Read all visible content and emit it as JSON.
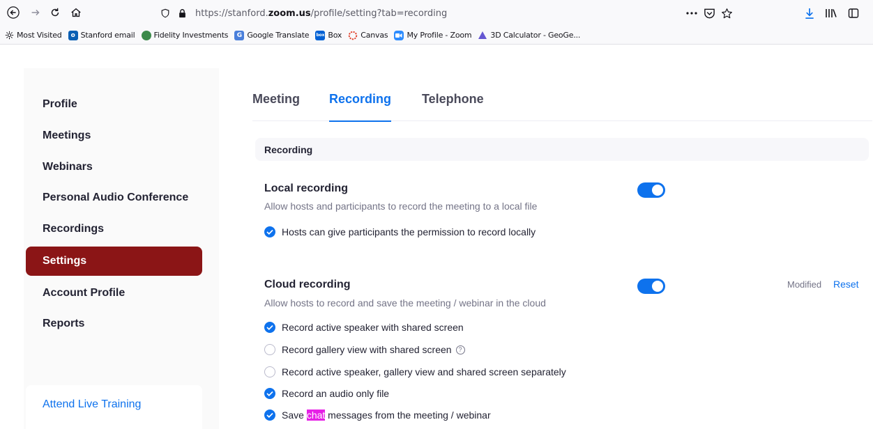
{
  "browser": {
    "url_prefix": "https://stanford.",
    "url_domain": "zoom.us",
    "url_path": "/profile/setting?tab=recording",
    "bookmarks": [
      {
        "label": "Most Visited",
        "icon": "gear-icon"
      },
      {
        "label": "Stanford email",
        "icon": "outlook-icon"
      },
      {
        "label": "Fidelity Investments",
        "icon": "fidelity-icon"
      },
      {
        "label": "Google Translate",
        "icon": "translate-icon"
      },
      {
        "label": "Box",
        "icon": "box-icon"
      },
      {
        "label": "Canvas",
        "icon": "canvas-icon"
      },
      {
        "label": "My Profile - Zoom",
        "icon": "zoom-icon"
      },
      {
        "label": "3D Calculator - GeoGe...",
        "icon": "geogebra-icon"
      }
    ],
    "box_badge": "box"
  },
  "sidebar": {
    "items": [
      {
        "label": "Profile",
        "active": false
      },
      {
        "label": "Meetings",
        "active": false
      },
      {
        "label": "Webinars",
        "active": false
      },
      {
        "label": "Personal Audio Conference",
        "active": false
      },
      {
        "label": "Recordings",
        "active": false
      },
      {
        "label": "Settings",
        "active": true
      },
      {
        "label": "Account Profile",
        "active": false
      },
      {
        "label": "Reports",
        "active": false
      }
    ],
    "training_link": "Attend Live Training"
  },
  "tabs": [
    {
      "label": "Meeting",
      "active": false
    },
    {
      "label": "Recording",
      "active": true
    },
    {
      "label": "Telephone",
      "active": false
    }
  ],
  "section_header": "Recording",
  "local_recording": {
    "title": "Local recording",
    "description": "Allow hosts and participants to record the meeting to a local file",
    "enabled": true,
    "options": [
      {
        "label": "Hosts can give participants the permission to record locally",
        "checked": true
      }
    ]
  },
  "cloud_recording": {
    "title": "Cloud recording",
    "description": "Allow hosts to record and save the meeting / webinar in the cloud",
    "enabled": true,
    "modified_label": "Modified",
    "reset_label": "Reset",
    "options": [
      {
        "label": "Record active speaker with shared screen",
        "checked": true
      },
      {
        "label": "Record gallery view with shared screen",
        "checked": false
      },
      {
        "label": "Record active speaker, gallery view and shared screen separately",
        "checked": false
      },
      {
        "label": "Record an audio only file",
        "checked": true
      }
    ],
    "save_chat": {
      "before": "Save ",
      "highlight": "chat",
      "after": " messages from the meeting / webinar",
      "checked": true
    },
    "help_glyph": "?"
  },
  "colors": {
    "accent": "#0e72ed",
    "active_sidebar": "#8b1516",
    "chat_highlight": "#e620e6"
  }
}
